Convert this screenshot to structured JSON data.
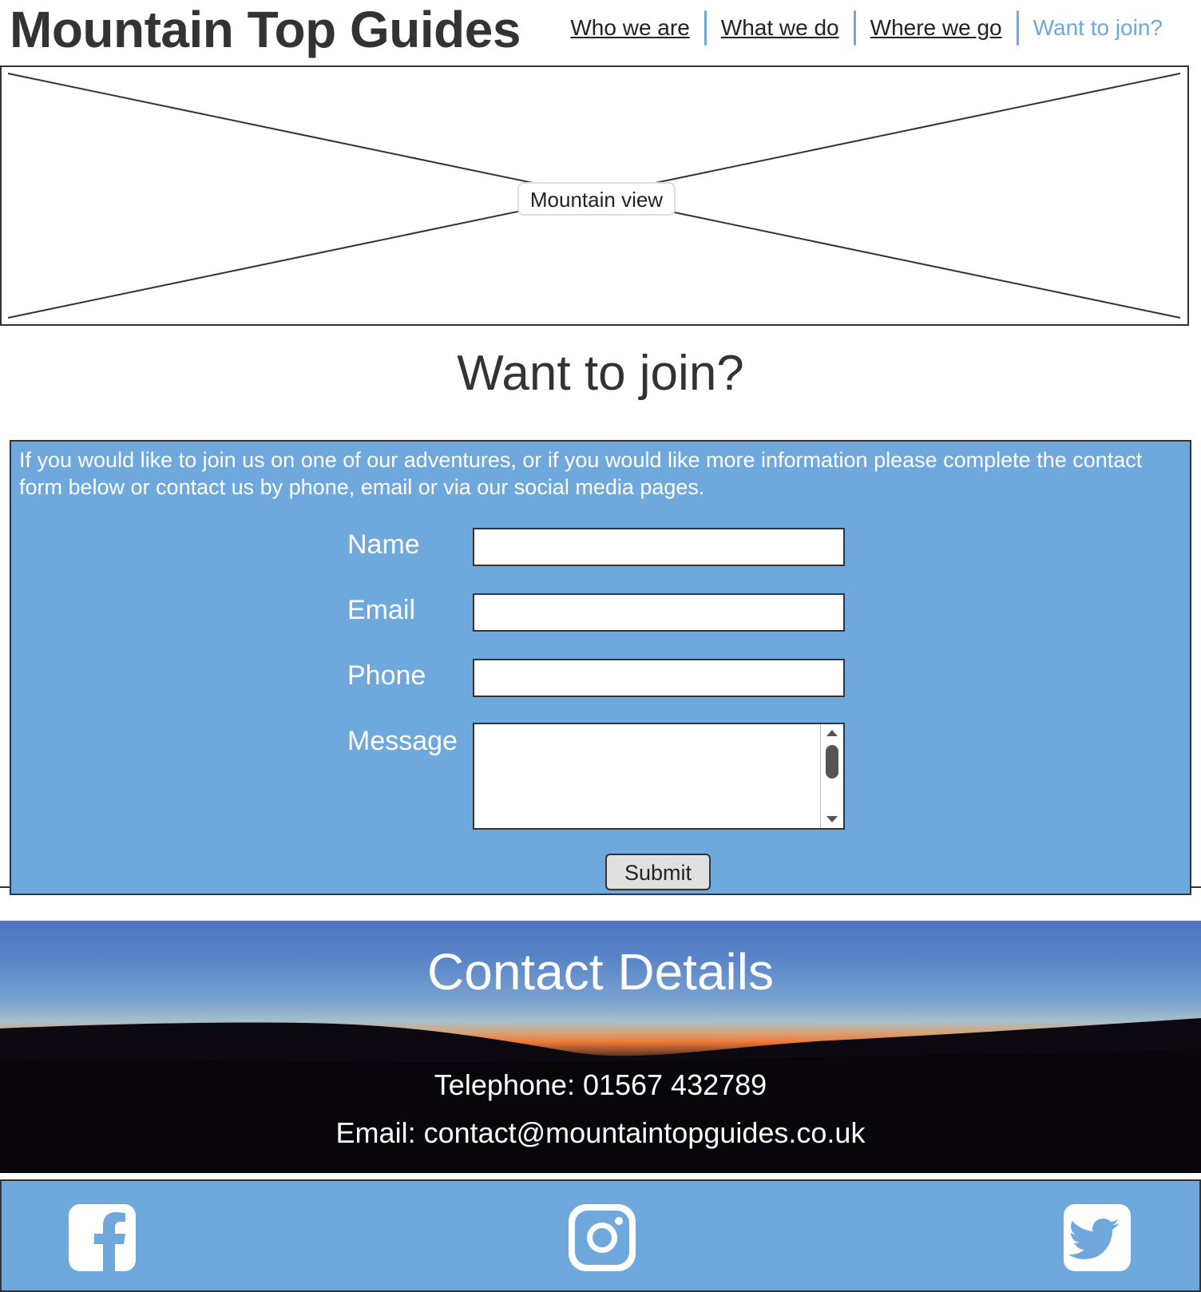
{
  "header": {
    "site_title": "Mountain Top Guides",
    "nav": [
      {
        "label": "Who we are",
        "active": false
      },
      {
        "label": "What we do",
        "active": false
      },
      {
        "label": "Where we go",
        "active": false
      },
      {
        "label": "Want to join?",
        "active": true
      }
    ]
  },
  "hero": {
    "alt_text": "Mountain view"
  },
  "main": {
    "heading": "Want to join?",
    "intro": "If you would like to join us on one of our adventures, or if you would like more information please complete the contact form below or contact us by phone, email or via our social media pages.",
    "form": {
      "name_label": "Name",
      "name_value": "",
      "email_label": "Email",
      "email_value": "",
      "phone_label": "Phone",
      "phone_value": "",
      "message_label": "Message",
      "message_value": "",
      "submit_label": "Submit"
    }
  },
  "contact": {
    "heading": "Contact Details",
    "phone": "Telephone: 01567 432789",
    "email": "Email: contact@mountaintopguides.co.uk"
  },
  "social": {
    "icons": [
      "facebook-icon",
      "instagram-icon",
      "twitter-icon"
    ]
  },
  "colors": {
    "accent": "#6fa8dc",
    "text": "#333333",
    "white": "#ffffff"
  }
}
